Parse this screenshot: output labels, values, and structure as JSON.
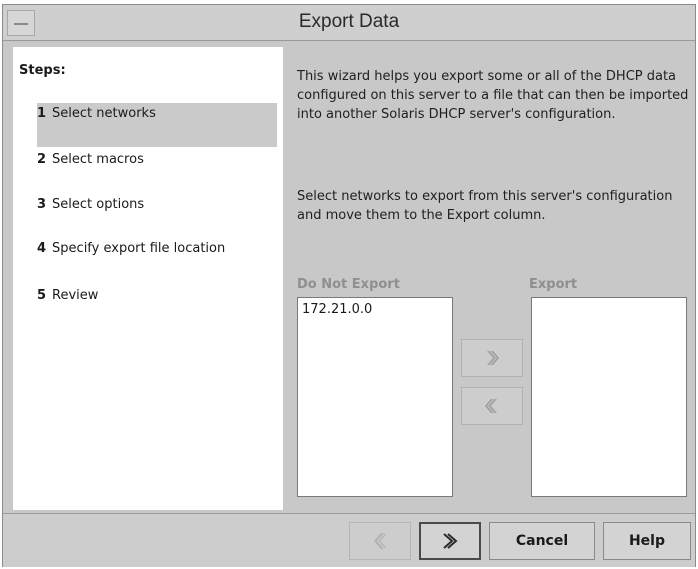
{
  "window": {
    "title": "Export Data"
  },
  "steps": {
    "heading": "Steps:",
    "items": [
      {
        "number": "1",
        "label": "Select networks",
        "selected": true
      },
      {
        "number": "2",
        "label": "Select macros",
        "selected": false
      },
      {
        "number": "3",
        "label": "Select options",
        "selected": false
      },
      {
        "number": "4",
        "label": "Specify export file location",
        "selected": false
      },
      {
        "number": "5",
        "label": "Review",
        "selected": false
      }
    ]
  },
  "content": {
    "intro": "This wizard helps you export some or all of the DHCP data configured on this server to a file that can then be imported into another Solaris DHCP server's configuration.",
    "instructions": "Select networks to export from this server's configuration and move them to the Export column.",
    "do_not_export_label": "Do Not Export",
    "export_label": "Export",
    "do_not_export_items": [
      "172.21.0.0"
    ],
    "export_items": []
  },
  "footer": {
    "cancel_label": "Cancel",
    "help_label": "Help"
  },
  "colors": {
    "window_bg": "#c8c8c8",
    "panel_bg": "#ffffff",
    "selected_step_bg": "#cacaca",
    "disabled_text": "#8f8f8f"
  },
  "icons": {
    "move_right": "double-chevron-right-icon",
    "move_left": "double-chevron-left-icon",
    "back": "back-arrow-icon",
    "next": "next-arrow-icon"
  }
}
